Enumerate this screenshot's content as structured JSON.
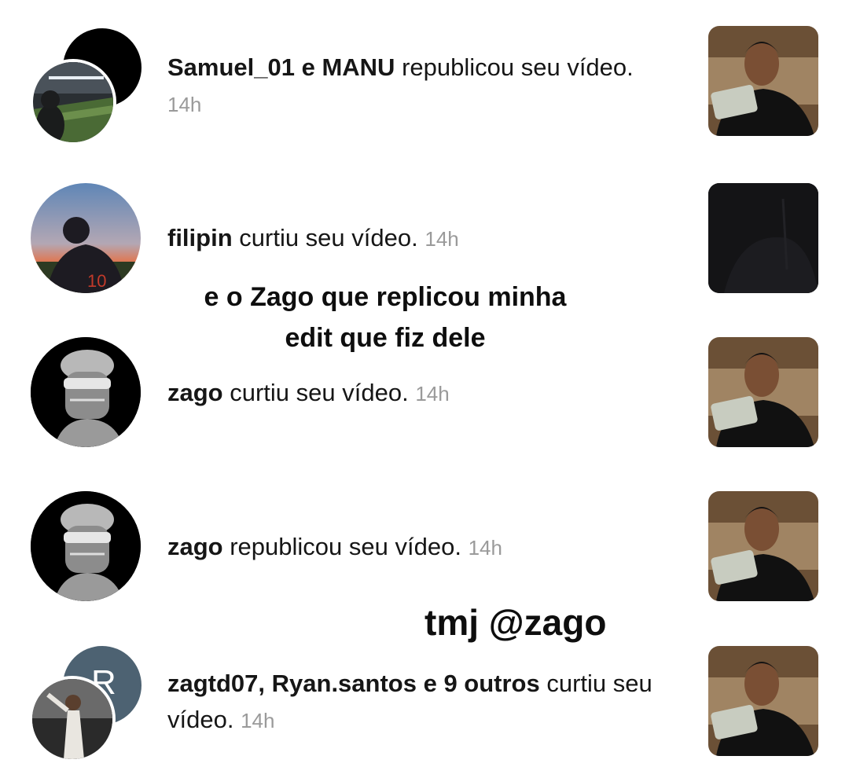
{
  "notifications": [
    {
      "user": "Samuel_01 e MANU",
      "action": " republicou seu vídeo.",
      "time": "14h"
    },
    {
      "user": "filipin",
      "action": " curtiu seu vídeo.",
      "time": "14h"
    },
    {
      "user": "zago",
      "action": " curtiu seu vídeo.",
      "time": "14h"
    },
    {
      "user": "zago",
      "action": " republicou seu vídeo.",
      "time": "14h"
    },
    {
      "user": "zagtd07, Ryan.santos e 9 outros",
      "action": " curtiu seu vídeo.",
      "time": "14h",
      "avatar_letter": "R"
    }
  ],
  "overlays": {
    "caption_line1": "e o Zago que replicou minha",
    "caption_line2": "edit que fiz dele",
    "caption_tmj": "tmj @zago"
  }
}
